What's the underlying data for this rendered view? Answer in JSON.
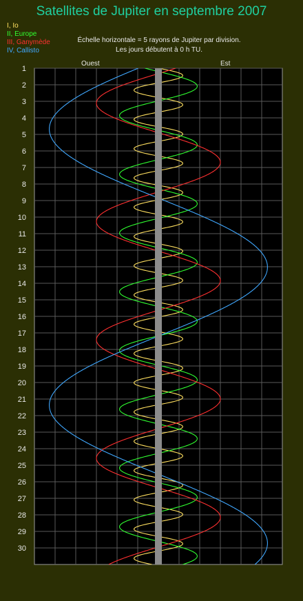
{
  "title": "Satellites de Jupiter en septembre 2007",
  "legend": [
    {
      "label": "I, Io",
      "color": "#ffe060"
    },
    {
      "label": "II, Europe",
      "color": "#30ff30"
    },
    {
      "label": "III, Ganymède",
      "color": "#ff3030"
    },
    {
      "label": "IV, Callisto",
      "color": "#40a8ff"
    }
  ],
  "notes": {
    "scale": "Échelle horizontale = 5 rayons de Jupiter par division.",
    "start": "Les jours débutent à 0 h TU."
  },
  "axis": {
    "west_label": "Ouest",
    "east_label": "Est"
  },
  "chart_data": {
    "type": "line",
    "title": "Satellites de Jupiter en septembre 2007",
    "xlabel": "",
    "ylabel": "",
    "x_unit": "rayons de Jupiter",
    "xlim": [
      -30,
      30
    ],
    "ylim": [
      1,
      31
    ],
    "grid": true,
    "days": [
      "1",
      "2",
      "3",
      "4",
      "5",
      "6",
      "7",
      "8",
      "9",
      "10",
      "11",
      "12",
      "13",
      "14",
      "15",
      "16",
      "17",
      "18",
      "19",
      "20",
      "21",
      "22",
      "23",
      "24",
      "25",
      "26",
      "27",
      "28",
      "29",
      "30"
    ],
    "series": [
      {
        "name": "I, Io",
        "color": "#ffe060",
        "amplitude": 5.9,
        "period_days": 1.769,
        "phase_day": 1.0
      },
      {
        "name": "II, Europe",
        "color": "#30ff30",
        "amplitude": 9.4,
        "period_days": 3.551,
        "phase_day": 4.75
      },
      {
        "name": "III, Ganymède",
        "color": "#ff3030",
        "amplitude": 15.0,
        "period_days": 7.155,
        "phase_day": 4.9
      },
      {
        "name": "IV, Callisto",
        "color": "#40a8ff",
        "amplitude": 26.4,
        "period_days": 16.69,
        "phase_day": 8.85
      }
    ]
  }
}
